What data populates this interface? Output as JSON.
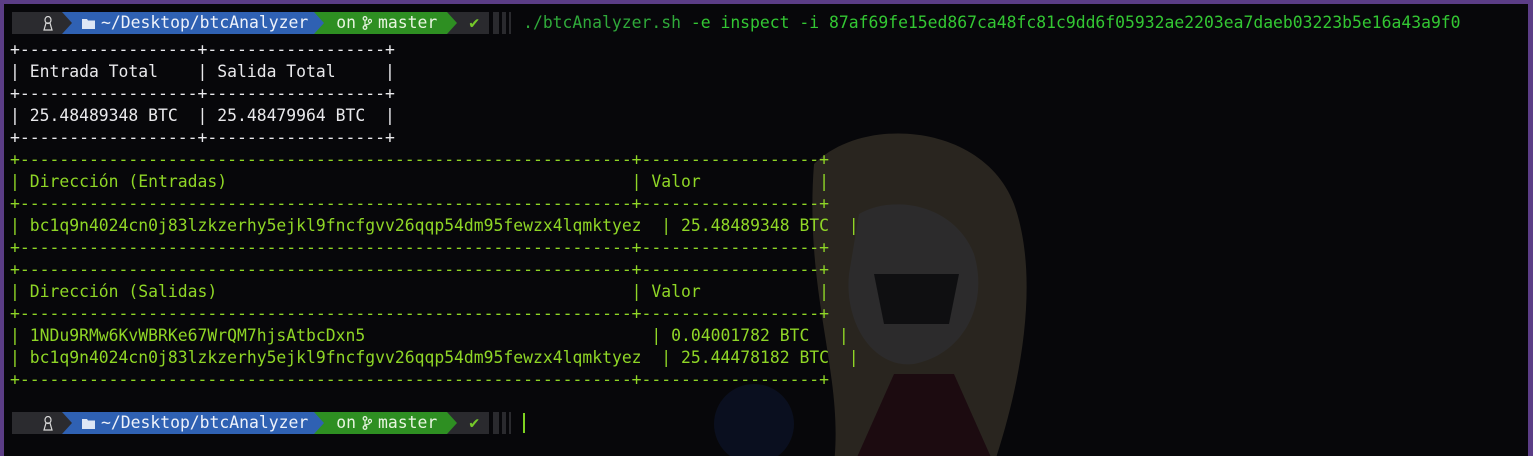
{
  "prompt": {
    "os_icon": "linux-tux-icon",
    "folder_icon": "folder-icon",
    "path": "~/Desktop/btcAnalyzer",
    "on_label": "on",
    "git_icon": "git-branch-icon",
    "branch": "master",
    "status_icon": "checkmark-icon",
    "status_symbol": "✔"
  },
  "command": {
    "script": "./btcAnalyzer.sh",
    "args": "-e inspect -i 87af69fe15ed867ca48fc81c9dd6f05932ae2203ea7daeb03223b5e16a43a9f0"
  },
  "totals_table": {
    "border": "+------------------+------------------+",
    "header": "| Entrada Total    | Salida Total     |",
    "row": "| 25.48489348 BTC  | 25.48479964 BTC  |"
  },
  "inputs_table": {
    "border": "+--------------------------------------------------------------+------------------+",
    "header": "| Dirección (Entradas)                                         | Valor            |",
    "rows": [
      "| bc1q9n4024cn0j83lzkzerhy5ejkl9fncfgvv26qqp54dm95fewzx4lqmktyez  | 25.48489348 BTC  |"
    ]
  },
  "outputs_table": {
    "border": "+--------------------------------------------------------------+------------------+",
    "header": "| Dirección (Salidas)                                          | Valor            |",
    "rows": [
      "| 1NDu9RMw6KvWBRKe67WrQM7hjsAtbcDxn5                             | 0.04001782 BTC   |",
      "| bc1q9n4024cn0j83lzkzerhy5ejkl9fncfgvv26qqp54dm95fewzx4lqmktyez  | 25.44478182 BTC  |"
    ]
  },
  "colors": {
    "background": "#07070a",
    "frame": "#5b3d86",
    "table_green": "#8fd626",
    "command_green": "#33c733",
    "dir_segment": "#2f61b3",
    "git_segment": "#2e8f22"
  }
}
